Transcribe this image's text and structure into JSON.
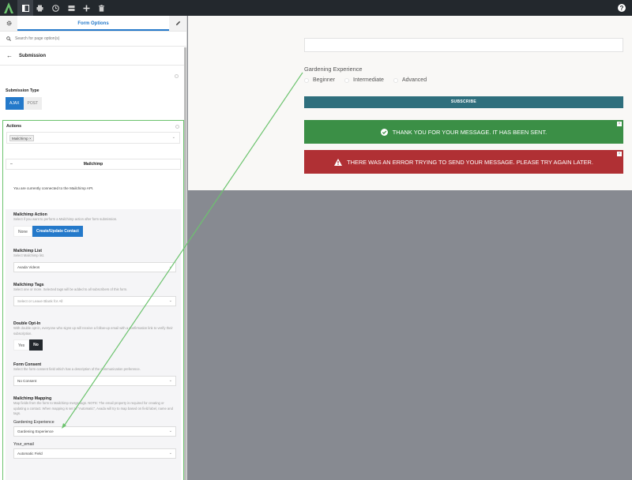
{
  "toolbar": {
    "icons": [
      "avada-logo",
      "sidebar-icon",
      "print-icon",
      "history-icon",
      "layers-icon",
      "add-icon",
      "trash-icon",
      "help-icon"
    ],
    "help_label": "?"
  },
  "sidebar": {
    "tab_title": "Form Options",
    "search_placeholder": "Search for page option(s)",
    "section_title": "Submission",
    "submission_type": {
      "label": "Submission Type",
      "options": [
        "AJAX",
        "POST"
      ],
      "selected": "AJAX"
    },
    "actions": {
      "label": "Actions",
      "selected_tag": "Mailchimp"
    },
    "mailchimp": {
      "title": "Mailchimp",
      "collapse_symbol": "–",
      "connected_text": "You are currently connected to the Mailchimp API.",
      "action": {
        "label": "Mailchimp Action",
        "desc": "Select if you want to perform a Mailchimp action after form submission.",
        "options": [
          "None",
          "Create/Update Contact"
        ],
        "selected": "Create/Update Contact"
      },
      "list": {
        "label": "Mailchimp List",
        "desc": "Select Mailchimp list.",
        "value": "Avada Videos"
      },
      "tags": {
        "label": "Mailchimp Tags",
        "desc": "Select one or more. Selected tags will be added to all subscribers of this form.",
        "placeholder": "Select or Leave Blank for All"
      },
      "double_opt_in": {
        "label": "Double Opt-In",
        "desc": "With double opt-in, everyone who signs up will receive a follow-up email with a confirmation link to verify their subscription.",
        "options": [
          "Yes",
          "No"
        ],
        "selected": "No"
      },
      "consent": {
        "label": "Form Consent",
        "desc": "Select the form consent field which has a description of the communication preference.",
        "value": "No Consent"
      },
      "mapping": {
        "label": "Mailchimp Mapping",
        "desc": "Map fields from the form to Mailchimp merge tags. NOTE: The email property is required for creating or updating a contact. When mapping is set to \"Automatic\", Avada will try to map based on field label, name and tags.",
        "fields": [
          {
            "name": "Gardening Experience",
            "value": "Gardening Experience"
          },
          {
            "name": "Your_email",
            "value": "Automatic Field"
          }
        ]
      }
    }
  },
  "preview": {
    "question_label": "Gardening Experience",
    "options": [
      "Beginner",
      "Intermediate",
      "Advanced"
    ],
    "subscribe_label": "SUBSCRIBE",
    "success_message": "THANK YOU FOR YOUR MESSAGE. IT HAS BEEN SENT.",
    "error_message": "THERE WAS AN ERROR TRYING TO SEND YOUR MESSAGE. PLEASE TRY AGAIN LATER.",
    "close_symbol": "×"
  },
  "colors": {
    "accent_blue": "#2479ca",
    "toolbar_dark": "#23282d",
    "subscribe_teal": "#2f6f7d",
    "success_green": "#3b8f46",
    "error_red": "#b03034",
    "annotation_green": "#6cc36e",
    "canvas_gray": "#878a91"
  }
}
